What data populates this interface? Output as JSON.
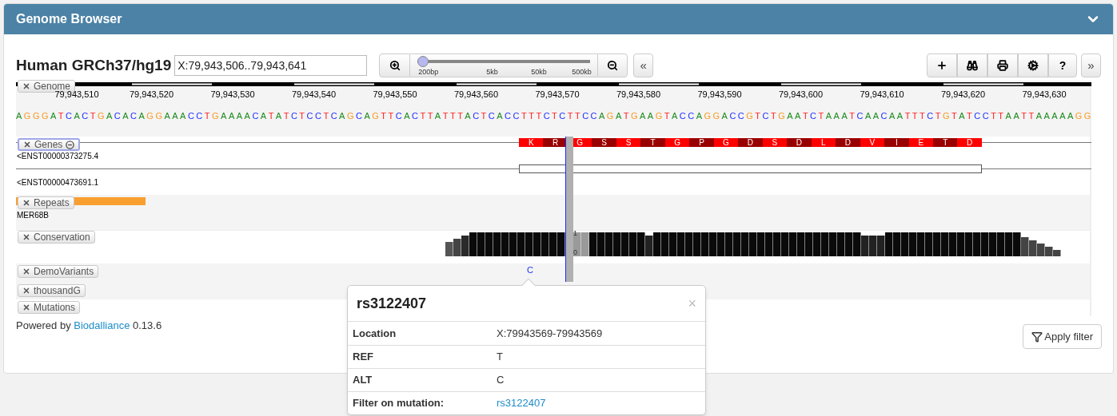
{
  "panel": {
    "title": "Genome Browser",
    "expanded": true
  },
  "toolbar": {
    "genome": "Human GRCh37/hg19",
    "location": "X:79,943,506..79,943,641",
    "zoom": {
      "level": 0,
      "labels": [
        "200bp",
        "5kb",
        "50kb",
        "500kb"
      ]
    },
    "left_arrow": "«",
    "right_arrow": "»",
    "help": "?"
  },
  "ruler": {
    "ticks": [
      "79,943,510",
      "79,943,520",
      "79,943,530",
      "79,943,540",
      "79,943,550",
      "79,943,560",
      "79,943,570",
      "79,943,580",
      "79,943,590",
      "79,943,600",
      "79,943,610",
      "79,943,620",
      "79,943,630"
    ]
  },
  "sequence": "AGGGATCACTGACACAGGAAACCTGAAAACATATCTCCTCAGCAGTTCACTTATTTACTCACCTTTCTCTTCCAGATGAAGTACCAGGACCGTCTGAATCTAAATCAACAATTTCTGTATCCTTAATTAAAAAGG",
  "tracks": [
    {
      "kind": "genome",
      "label": "Genome",
      "selected": false
    },
    {
      "kind": "genes",
      "label": "Genes",
      "selected": true,
      "transcripts": [
        {
          "name": "<ENST00000373275.4",
          "residues": [
            "K",
            "R",
            "G",
            "S",
            "S",
            "T",
            "G",
            "P",
            "G",
            "D",
            "S",
            "D",
            "L",
            "D",
            "V",
            "I",
            "E",
            "T",
            "D"
          ]
        },
        {
          "name": "<ENST00000473691.1"
        }
      ]
    },
    {
      "kind": "repeats",
      "label": "Repeats",
      "selected": false,
      "feature": "MER68B"
    },
    {
      "kind": "conservation",
      "label": "Conservation",
      "selected": false,
      "axis_max": "1",
      "axis_min": "0"
    },
    {
      "kind": "variants",
      "label": "DemoVariants",
      "selected": false,
      "allele": "C"
    },
    {
      "kind": "plain",
      "label": "thousandG",
      "selected": false
    },
    {
      "kind": "plain",
      "label": "Mutations",
      "selected": false
    }
  ],
  "footer": {
    "prefix": "Powered by",
    "link": "Biodalliance",
    "version": "0.13.6"
  },
  "apply_filter": "Apply filter",
  "popup": {
    "title": "rs3122407",
    "close": "×",
    "rows": [
      {
        "label": "Location",
        "value": "X:79943569-79943569",
        "kind": "text"
      },
      {
        "label": "REF",
        "value": "T",
        "kind": "text"
      },
      {
        "label": "ALT",
        "value": "C",
        "kind": "text"
      },
      {
        "label": "Filter on mutation:",
        "value": "rs3122407",
        "kind": "link"
      }
    ]
  }
}
